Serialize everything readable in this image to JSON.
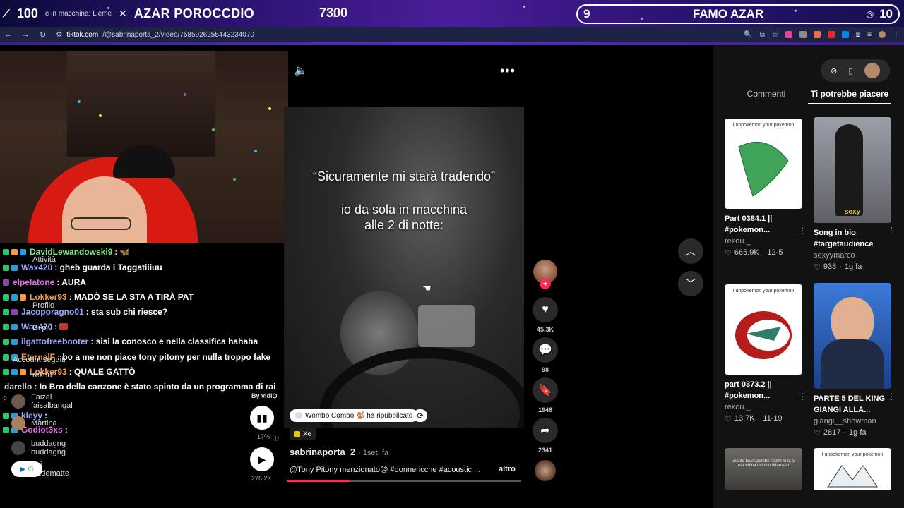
{
  "banner": {
    "left_num": "100",
    "left_small": "e in macchina: L'eme",
    "title": "AZAR POROCCDIO",
    "score": "7300",
    "pill_left": "9",
    "pill_mid": "FAMO AZAR",
    "pill_right": "10"
  },
  "browser": {
    "url_host": "tiktok.com",
    "url_path": "/@sabrinaporta_2/video/7585926255443234070"
  },
  "chat": {
    "rows": [
      {
        "user": "DavidLewandowski9",
        "msg": ":",
        "color": "#7ee787"
      },
      {
        "user": "Wax420",
        "msg": ": gheb guarda i Taggatiiiuu",
        "color": "#9aa7ff"
      },
      {
        "user": "elpelatone",
        "msg": ": AURA",
        "color": "#e86de8"
      },
      {
        "user": "Lokker93",
        "msg": ": MADÒ SE LA STA A TIRÀ PAT",
        "color": "#f2994a"
      },
      {
        "user": "Jacoporagno01",
        "msg": ": sta sub chi riesce?",
        "color": "#9aa7ff"
      },
      {
        "user": "Wax420",
        "msg": ":",
        "color": "#9aa7ff"
      },
      {
        "user": "ilgattofreebooter",
        "msg": ": sisi la conosco e nella classifica hahaha",
        "color": "#9aa7ff"
      },
      {
        "user": "EternalF",
        "msg": ": bo a me non piace tony pitony per nulla troppo fake",
        "color": "#f2994a"
      },
      {
        "user": "Lokker93",
        "msg": ": QUALE GATTÒ",
        "color": "#f2994a"
      },
      {
        "user": "darello",
        "msg": ": Io Bro della canzone è stato spinto da un programma di rai",
        "color": "#cfcfcf"
      },
      {
        "user": "kleyy",
        "msg": ":",
        "color": "#9aa7ff"
      },
      {
        "user": "Godiot3xs",
        "msg": ":",
        "color": "#e86de8"
      }
    ],
    "overlay_items": {
      "attivita": "Attività",
      "profilo": "Profilo",
      "altro": "Di più",
      "account_seguiti": "Account seguiti",
      "rekou": "rekou",
      "num2": "2"
    },
    "suggestions": [
      {
        "name": "Faizal",
        "handle": "faisalbangal"
      },
      {
        "name": "Martina",
        "handle": ""
      },
      {
        "name": "buddagng",
        "handle": "buddagng"
      },
      {
        "name": "Ari",
        "handle": "aridematte"
      }
    ]
  },
  "video": {
    "quote": "“Sicuramente mi starà tradendo”",
    "sub_line1": "io da sola in macchina",
    "sub_line2": "alle 2 di notte:",
    "by_vidiq": "By vidIQ",
    "vq_percent": "17%",
    "vq_views": "276.2K",
    "repost_text": "Wombo Combo 🐒 ha ripubblicato",
    "tag": "Xe",
    "author": "sabrinaporta_2",
    "date": "· 1set. fa",
    "caption": "@Tony Pitony menzionato😡 #donnericche #acoustic ...",
    "more": "altro",
    "progress": 0.27
  },
  "rail": {
    "likes": "45.3K",
    "comments": "98",
    "saves": "1948",
    "shares": "2341"
  },
  "rpanel": {
    "tabs": [
      "Commenti",
      "Ti potrebbe piacere"
    ],
    "cards": [
      {
        "title_l1": "Part 0384.1 ||",
        "title_l2": "#pokemon...",
        "author": "rekou._",
        "likes": "665.9K",
        "date": "12-5",
        "thumb_label": "I unpokemon your pokemon",
        "overlay": ""
      },
      {
        "title_l1": "Song in bio",
        "title_l2": "#targetaudience",
        "author": "sexyymarco",
        "likes": "938",
        "date": "1g fa",
        "thumb_label": "",
        "overlay": "sexy"
      },
      {
        "title_l1": "part 0373.2 ||",
        "title_l2": "#pokemon...",
        "author": "rekou._",
        "likes": "13.7K",
        "date": "11-19",
        "thumb_label": "I unpokemon your pokemon",
        "overlay": ""
      },
      {
        "title_l1": "PARTE 5 DEL KING",
        "title_l2": "GIANGI ALLA...",
        "author": "giangi__showman",
        "likes": "2817",
        "date": "1g fa",
        "thumb_label": "",
        "overlay": ""
      },
      {
        "title_l1": "",
        "title_l2": "",
        "author": "",
        "likes": "",
        "date": "",
        "thumb_label": "Vestita basic perché l'outfit lo fa la macchina del mio fidanzato",
        "overlay": ""
      },
      {
        "title_l1": "",
        "title_l2": "",
        "author": "",
        "likes": "",
        "date": "",
        "thumb_label": "I unpokemon your pokemon",
        "overlay": ""
      }
    ]
  }
}
